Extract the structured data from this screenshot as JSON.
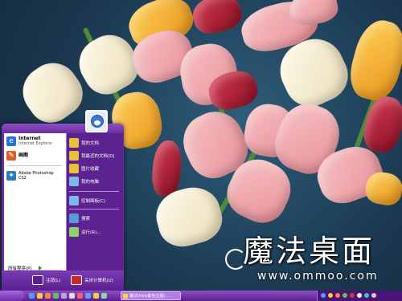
{
  "logo": {
    "chars": "魔法桌面",
    "url": "www.ommoo.com"
  },
  "start_menu": {
    "pinned": [
      {
        "title": "Internet",
        "subtitle": "Internet Explorer",
        "icon": "internet-explorer-icon",
        "color": "#2a6fd6"
      },
      {
        "title": "画图",
        "subtitle": "",
        "icon": "paint-icon",
        "color": "#d6622a"
      }
    ],
    "recent": [
      {
        "title": "Adobe Photoshop",
        "subtitle": "CS2",
        "icon": "photoshop-icon",
        "color": "#2a7fb8"
      }
    ],
    "places": [
      {
        "label": "我的文档",
        "icon": "documents-icon",
        "color": "#e8c13a"
      },
      {
        "label": "我最近的文档(D)",
        "icon": "recent-documents-icon",
        "color": "#e8c13a"
      },
      {
        "label": "图片收藏",
        "icon": "pictures-icon",
        "color": "#e8c13a"
      },
      {
        "label": "我的电脑",
        "icon": "computer-icon",
        "color": "#7fb5e8"
      }
    ],
    "system": [
      {
        "label": "控制面板(C)",
        "icon": "control-panel-icon",
        "color": "#7fb5e8"
      },
      {
        "label": "搜索",
        "icon": "search-icon",
        "color": "#5a9ad8"
      },
      {
        "label": "运行(R)...",
        "icon": "run-icon",
        "color": "#8fd06a"
      }
    ],
    "all_programs": "所有程序(P)",
    "logoff_label": "注销(L)",
    "shutdown_label": "关闭计算机(U)"
  },
  "taskbar": {
    "start_label": "",
    "task_label": "魔法Vista紫色主题(...",
    "clock": "",
    "quick_colors": [
      "#4ea0ff",
      "#f0d040",
      "#ff8040",
      "#60c060"
    ],
    "tray_colors": [
      "#4ea0ff",
      "#f0d040",
      "#ff8040",
      "#60c060",
      "#c04040",
      "#ffffff",
      "#40c0c0",
      "#d0d0d0"
    ]
  },
  "colors": {
    "accent": "#6a2c9e",
    "taskbar": "#5a1e8e"
  }
}
